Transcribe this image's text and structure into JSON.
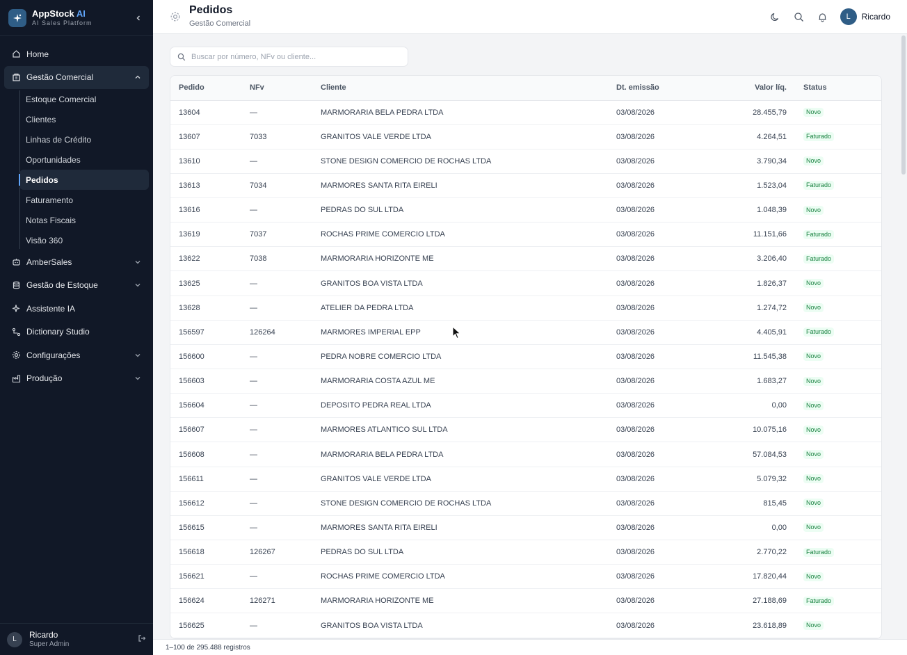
{
  "brand": {
    "name": "AppStock",
    "name_ai": "AI",
    "subtitle": "AI Sales Platform"
  },
  "sidebar": {
    "items": [
      {
        "key": "home",
        "label": "Home",
        "icon": "home-icon"
      },
      {
        "key": "gestao-comercial",
        "label": "Gestão Comercial",
        "icon": "building-icon",
        "expanded": true,
        "children": [
          "Estoque Comercial",
          "Clientes",
          "Linhas de Crédito",
          "Oportunidades",
          "Pedidos",
          "Faturamento",
          "Notas Fiscais",
          "Visão 360"
        ],
        "active_child": "Pedidos"
      },
      {
        "key": "ambersales",
        "label": "AmberSales",
        "icon": "robot-icon"
      },
      {
        "key": "gestao-estoque",
        "label": "Gestão de Estoque",
        "icon": "database-icon"
      },
      {
        "key": "assistente-ia",
        "label": "Assistente IA",
        "icon": "sparkles-icon"
      },
      {
        "key": "dictionary-studio",
        "label": "Dictionary Studio",
        "icon": "workflow-icon"
      },
      {
        "key": "configuracoes",
        "label": "Configurações",
        "icon": "gear-icon"
      },
      {
        "key": "producao",
        "label": "Produção",
        "icon": "factory-icon"
      }
    ]
  },
  "user": {
    "name": "Ricardo",
    "role": "Super Admin",
    "initial": "L"
  },
  "header": {
    "title": "Pedidos",
    "subtitle": "Gestão Comercial",
    "user_name": "Ricardo",
    "user_initial": "L"
  },
  "search": {
    "placeholder": "Buscar por número, NFv ou cliente...",
    "value": ""
  },
  "table": {
    "columns": [
      "Pedido",
      "NFv",
      "Cliente",
      "Dt. emissão",
      "Valor líq.",
      "Status"
    ],
    "rows": [
      [
        "13604",
        "—",
        "MARMORARIA BELA PEDRA LTDA",
        "03/08/2026",
        "28.455,79",
        "Novo"
      ],
      [
        "13607",
        "7033",
        "GRANITOS VALE VERDE LTDA",
        "03/08/2026",
        "4.264,51",
        "Faturado"
      ],
      [
        "13610",
        "—",
        "STONE DESIGN COMERCIO DE ROCHAS LTDA",
        "03/08/2026",
        "3.790,34",
        "Novo"
      ],
      [
        "13613",
        "7034",
        "MARMORES SANTA RITA EIRELI",
        "03/08/2026",
        "1.523,04",
        "Faturado"
      ],
      [
        "13616",
        "—",
        "PEDRAS DO SUL LTDA",
        "03/08/2026",
        "1.048,39",
        "Novo"
      ],
      [
        "13619",
        "7037",
        "ROCHAS PRIME COMERCIO LTDA",
        "03/08/2026",
        "11.151,66",
        "Faturado"
      ],
      [
        "13622",
        "7038",
        "MARMORARIA HORIZONTE ME",
        "03/08/2026",
        "3.206,40",
        "Faturado"
      ],
      [
        "13625",
        "—",
        "GRANITOS BOA VISTA LTDA",
        "03/08/2026",
        "1.826,37",
        "Novo"
      ],
      [
        "13628",
        "—",
        "ATELIER DA PEDRA LTDA",
        "03/08/2026",
        "1.274,72",
        "Novo"
      ],
      [
        "156597",
        "126264",
        "MARMORES IMPERIAL EPP",
        "03/08/2026",
        "4.405,91",
        "Faturado"
      ],
      [
        "156600",
        "—",
        "PEDRA NOBRE COMERCIO LTDA",
        "03/08/2026",
        "11.545,38",
        "Novo"
      ],
      [
        "156603",
        "—",
        "MARMORARIA COSTA AZUL ME",
        "03/08/2026",
        "1.683,27",
        "Novo"
      ],
      [
        "156604",
        "—",
        "DEPOSITO PEDRA REAL LTDA",
        "03/08/2026",
        "0,00",
        "Novo"
      ],
      [
        "156607",
        "—",
        "MARMORES ATLANTICO SUL LTDA",
        "03/08/2026",
        "10.075,16",
        "Novo"
      ],
      [
        "156608",
        "—",
        "MARMORARIA BELA PEDRA LTDA",
        "03/08/2026",
        "57.084,53",
        "Novo"
      ],
      [
        "156611",
        "—",
        "GRANITOS VALE VERDE LTDA",
        "03/08/2026",
        "5.079,32",
        "Novo"
      ],
      [
        "156612",
        "—",
        "STONE DESIGN COMERCIO DE ROCHAS LTDA",
        "03/08/2026",
        "815,45",
        "Novo"
      ],
      [
        "156615",
        "—",
        "MARMORES SANTA RITA EIRELI",
        "03/08/2026",
        "0,00",
        "Novo"
      ],
      [
        "156618",
        "126267",
        "PEDRAS DO SUL LTDA",
        "03/08/2026",
        "2.770,22",
        "Faturado"
      ],
      [
        "156621",
        "—",
        "ROCHAS PRIME COMERCIO LTDA",
        "03/08/2026",
        "17.820,44",
        "Novo"
      ],
      [
        "156624",
        "126271",
        "MARMORARIA HORIZONTE ME",
        "03/08/2026",
        "27.188,69",
        "Faturado"
      ],
      [
        "156625",
        "—",
        "GRANITOS BOA VISTA LTDA",
        "03/08/2026",
        "23.618,89",
        "Novo"
      ]
    ]
  },
  "footer": {
    "records": "1–100 de 295.488 registros"
  },
  "colors": {
    "sidebar_bg": "#111827",
    "accent": "#2f5d86",
    "badge_bg": "#ecfdf3",
    "badge_text": "#15803d"
  }
}
